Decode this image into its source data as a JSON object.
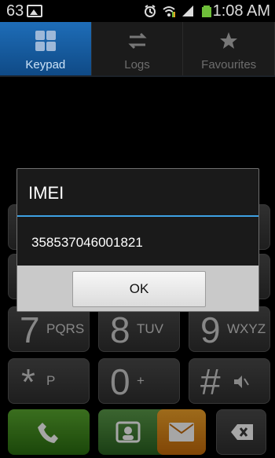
{
  "status_bar": {
    "left_number": "63",
    "time": "1:08 AM"
  },
  "tabs": [
    {
      "label": "Keypad",
      "active": true,
      "icon": "keypad-icon"
    },
    {
      "label": "Logs",
      "active": false,
      "icon": "logs-icon"
    },
    {
      "label": "Favourites",
      "active": false,
      "icon": "star-icon"
    }
  ],
  "keypad": {
    "row3": [
      {
        "digit": "7",
        "letters": "PQRS"
      },
      {
        "digit": "8",
        "letters": "TUV"
      },
      {
        "digit": "9",
        "letters": "WXYZ"
      }
    ],
    "row4": [
      {
        "digit": "*",
        "letters": "P"
      },
      {
        "digit": "0",
        "letters": "+"
      },
      {
        "digit": "#",
        "letters": ""
      }
    ]
  },
  "dialog": {
    "title": "IMEI",
    "message": "358537046001821",
    "ok_label": "OK"
  },
  "colors": {
    "accent_blue": "#1e6db8",
    "call_green": "#3d8f20",
    "message_orange": "#f2a42a"
  }
}
